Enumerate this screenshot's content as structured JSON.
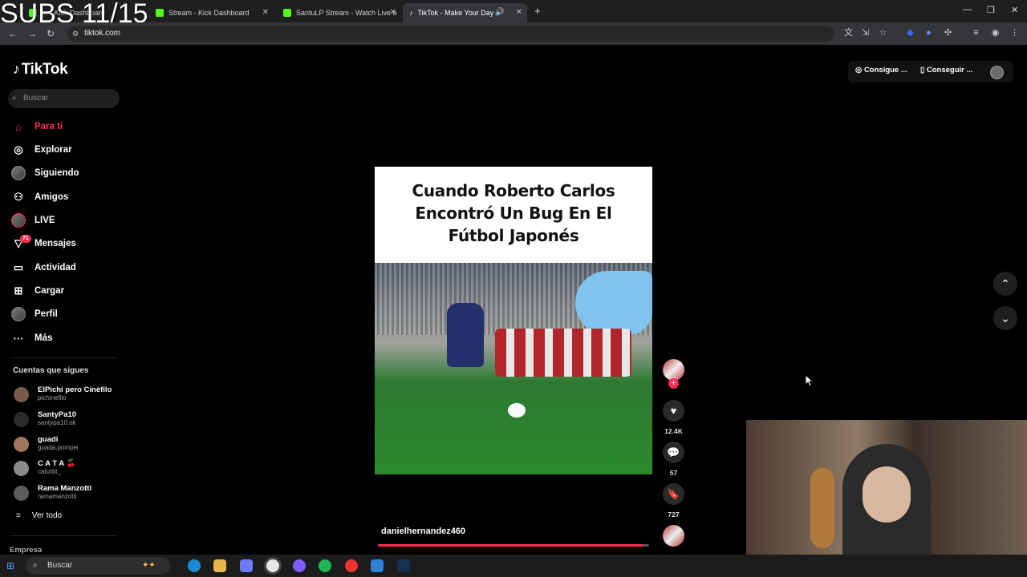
{
  "overlay": {
    "subs": "SUBS 11/15"
  },
  "browser": {
    "tabs": [
      {
        "label": "Stream - Kick Dashboard",
        "favicon_color": "#53fc18"
      },
      {
        "label": "SantuLP Stream - Watch Live o",
        "favicon_color": "#53fc18"
      },
      {
        "label": "TikTok - Make Your Day",
        "favicon_color": "#ffffff"
      }
    ],
    "partial_tab_label": "m - Kick Dashboard",
    "url": "tiktok.com"
  },
  "tiktok": {
    "logo": "TikTok",
    "search_placeholder": "Buscar",
    "nav": [
      {
        "label": "Para ti",
        "icon": "home-icon"
      },
      {
        "label": "Explorar",
        "icon": "compass-icon"
      },
      {
        "label": "Siguiendo",
        "icon": "following-avatar-icon"
      },
      {
        "label": "Amigos",
        "icon": "friends-icon"
      },
      {
        "label": "LIVE",
        "icon": "live-avatar-icon"
      },
      {
        "label": "Mensajes",
        "icon": "messages-icon",
        "badge": "71"
      },
      {
        "label": "Actividad",
        "icon": "activity-icon"
      },
      {
        "label": "Cargar",
        "icon": "upload-icon"
      },
      {
        "label": "Perfil",
        "icon": "profile-avatar-icon"
      },
      {
        "label": "Más",
        "icon": "more-icon"
      }
    ],
    "following_title": "Cuentas que sigues",
    "following": [
      {
        "name": "ElPichi pero Cinéfilo",
        "handle": "pichinefilo"
      },
      {
        "name": "SantyPa10",
        "handle": "santypa10.ok"
      },
      {
        "name": "guadi",
        "handle": "guada.pompei"
      },
      {
        "name": "C A T A 🍒",
        "handle": "catutiiii_"
      },
      {
        "name": "Rama Manzotti",
        "handle": "ramamanzotti"
      }
    ],
    "see_all": "Ver todo",
    "company": "Empresa",
    "actions": {
      "get_coins": "Consigue ...",
      "get_app": "Conseguir ..."
    },
    "video": {
      "title_line1": "Cuando Roberto Carlos",
      "title_line2": "Encontró Un Bug En El",
      "title_line3": "Fútbol Japonés",
      "author": "danielhernandez460",
      "likes": "12.4K",
      "comments": "57",
      "saves": "727",
      "progress": 0.98
    }
  },
  "taskbar": {
    "search_placeholder": "Buscar"
  }
}
